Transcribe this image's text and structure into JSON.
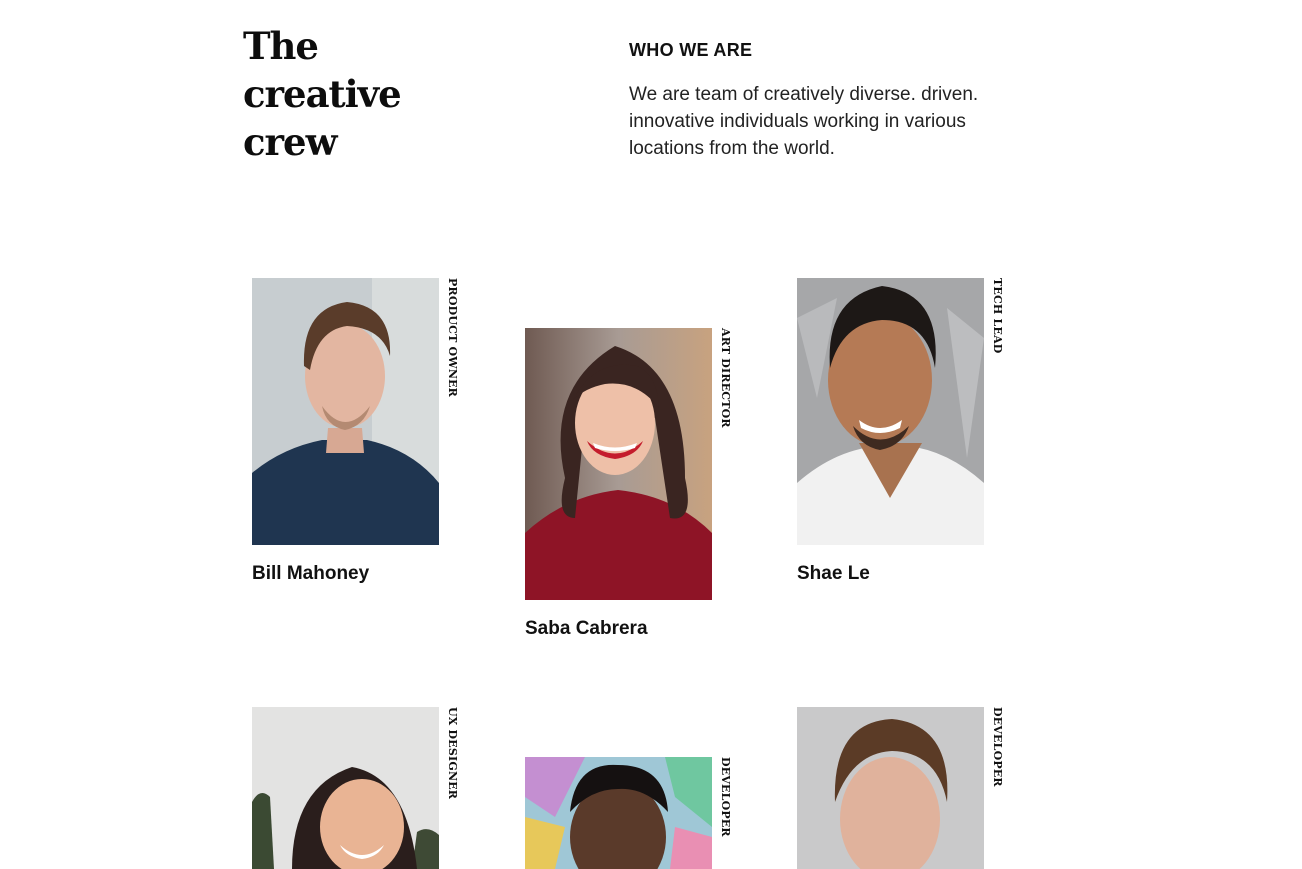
{
  "hero": {
    "title_lines": [
      "The",
      "creative",
      "crew"
    ]
  },
  "about": {
    "label": "WHO WE ARE",
    "text": "We are team of creatively diverse. driven. innovative individuals working in various locations from the world."
  },
  "team": [
    {
      "name": "Bill Mahoney",
      "role": "PRODUCT OWNER",
      "photo": "portrait-man-navy-polo"
    },
    {
      "name": "Saba Cabrera",
      "role": "ART DIRECTOR",
      "photo": "portrait-woman-red-sweater"
    },
    {
      "name": "Shae Le",
      "role": "TECH LEAD",
      "photo": "portrait-man-white-tshirt"
    },
    {
      "name": "",
      "role": "UX DESIGNER",
      "photo": "portrait-woman-laughing-palms"
    },
    {
      "name": "",
      "role": "DEVELOPER",
      "photo": "portrait-man-graffiti-wall"
    },
    {
      "name": "",
      "role": "DEVELOPER",
      "photo": "portrait-man-grey-background"
    }
  ],
  "colors": {
    "text": "#111111",
    "background": "#ffffff"
  }
}
